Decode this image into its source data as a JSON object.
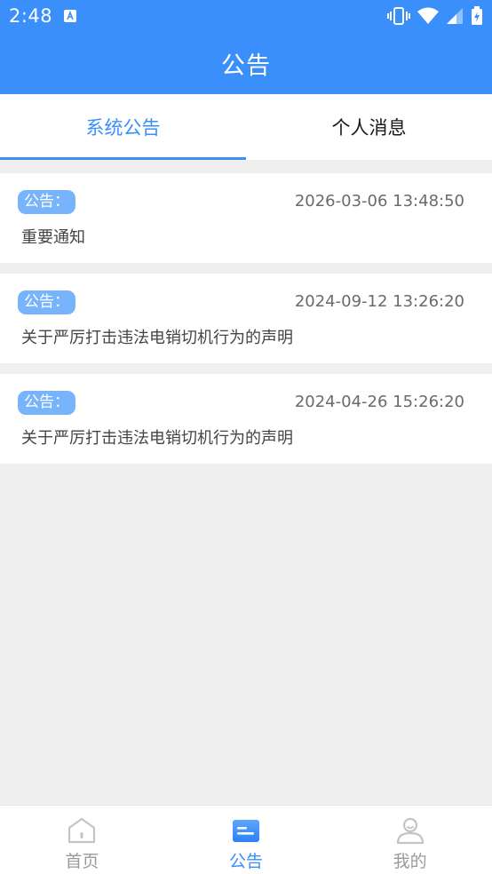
{
  "status_bar": {
    "time": "2:48"
  },
  "header": {
    "title": "公告"
  },
  "tabs": [
    {
      "label": "系统公告",
      "active": true
    },
    {
      "label": "个人消息",
      "active": false
    }
  ],
  "notices": [
    {
      "badge": "公告：",
      "time": "2026-03-06 13:48:50",
      "title": "重要通知"
    },
    {
      "badge": "公告：",
      "time": "2024-09-12 13:26:20",
      "title": "关于严厉打击违法电销切机行为的声明"
    },
    {
      "badge": "公告：",
      "time": "2024-04-26 15:26:20",
      "title": "关于严厉打击违法电销切机行为的声明"
    }
  ],
  "bottom_nav": [
    {
      "label": "首页",
      "icon": "home-icon",
      "active": false
    },
    {
      "label": "公告",
      "icon": "notice-icon",
      "active": true
    },
    {
      "label": "我的",
      "icon": "user-icon",
      "active": false
    }
  ],
  "colors": {
    "primary": "#3a8ffa",
    "badge": "#78b4fb",
    "background": "#efefef"
  }
}
